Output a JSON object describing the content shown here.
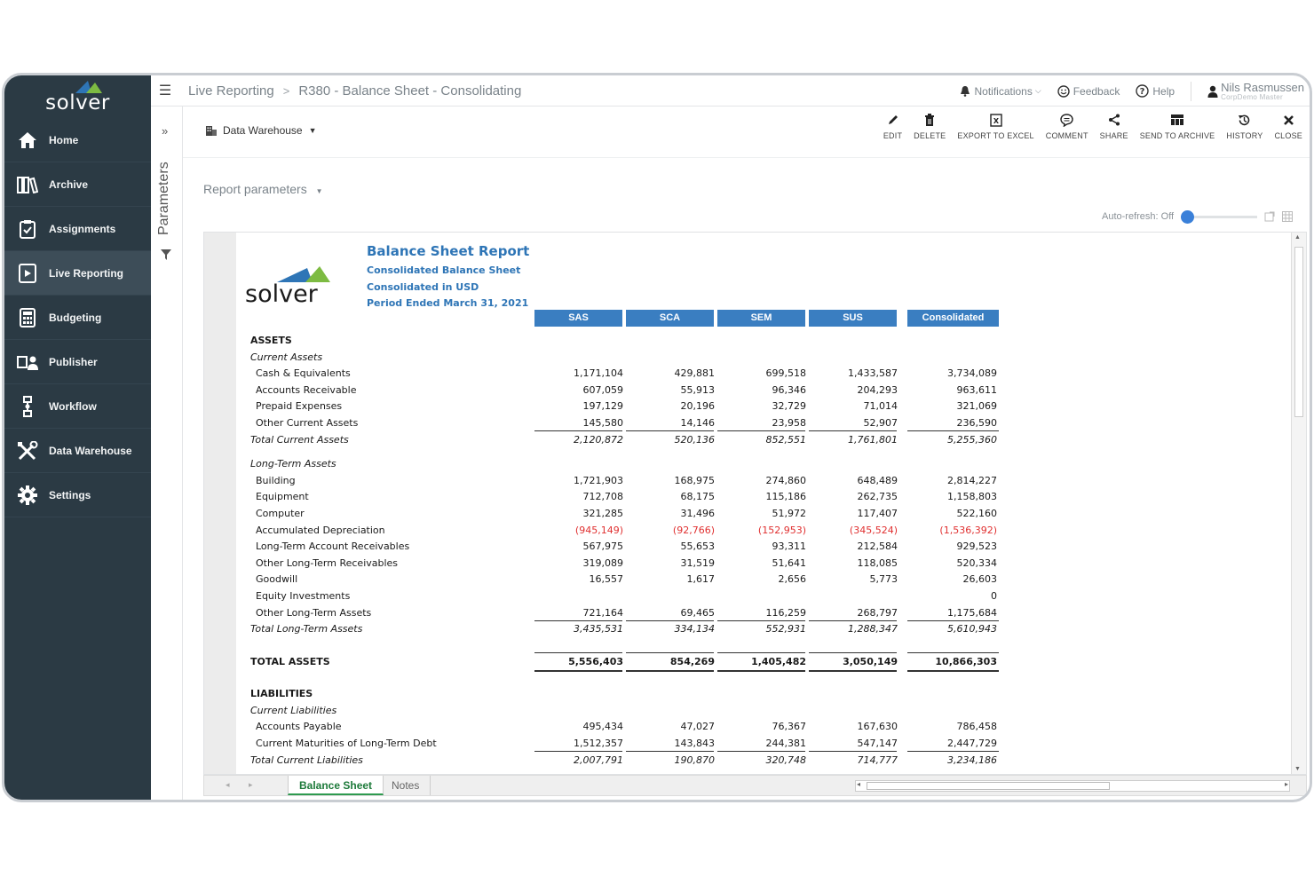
{
  "app": {
    "logo_text": "solver",
    "breadcrumb": [
      "Live Reporting",
      "R380 - Balance Sheet - Consolidating"
    ],
    "breadcrumb_sep": ">"
  },
  "sidebar": {
    "items": [
      {
        "label": "Home",
        "icon": "home-icon"
      },
      {
        "label": "Archive",
        "icon": "archive-icon"
      },
      {
        "label": "Assignments",
        "icon": "clipboard-icon"
      },
      {
        "label": "Live Reporting",
        "icon": "live-reporting-icon",
        "active": true
      },
      {
        "label": "Budgeting",
        "icon": "calculator-icon"
      },
      {
        "label": "Publisher",
        "icon": "publisher-icon"
      },
      {
        "label": "Workflow",
        "icon": "workflow-icon"
      },
      {
        "label": "Data Warehouse",
        "icon": "tools-icon"
      },
      {
        "label": "Settings",
        "icon": "gear-icon"
      }
    ]
  },
  "topbar": {
    "notifications": "Notifications",
    "feedback": "Feedback",
    "help": "Help",
    "user_name": "Nils Rasmussen",
    "user_role": "CorpDemo Master"
  },
  "toolbar": {
    "data_source": "Data Warehouse",
    "actions": [
      "EDIT",
      "DELETE",
      "EXPORT TO EXCEL",
      "COMMENT",
      "SHARE",
      "SEND TO ARCHIVE",
      "HISTORY",
      "CLOSE"
    ]
  },
  "params": {
    "strip_label": "Parameters",
    "report_params": "Report parameters",
    "auto_refresh": "Auto-refresh: Off",
    "auto_refresh_level": 0
  },
  "report": {
    "title": "Balance Sheet Report",
    "subtitle1": "Consolidated Balance Sheet",
    "subtitle2": "Consolidated in USD",
    "subtitle3": "Period Ended March 31, 2021",
    "logo_text": "solver",
    "columns": [
      "SAS",
      "SCA",
      "SEM",
      "SUS",
      "Consolidated"
    ],
    "rows": [
      {
        "type": "sec",
        "label": "ASSETS"
      },
      {
        "type": "sub",
        "label": "Current Assets"
      },
      {
        "type": "indent",
        "label": "Cash & Equivalents",
        "values": [
          "1,171,104",
          "429,881",
          "699,518",
          "1,433,587",
          "3,734,089"
        ]
      },
      {
        "type": "indent",
        "label": "Accounts Receivable",
        "values": [
          "607,059",
          "55,913",
          "96,346",
          "204,293",
          "963,611"
        ]
      },
      {
        "type": "indent",
        "label": "Prepaid Expenses",
        "values": [
          "197,129",
          "20,196",
          "32,729",
          "71,014",
          "321,069"
        ]
      },
      {
        "type": "indent",
        "label": "Other Current Assets",
        "values": [
          "145,580",
          "14,146",
          "23,958",
          "52,907",
          "236,590"
        ],
        "rule": true
      },
      {
        "type": "sub",
        "label": "Total Current Assets",
        "values": [
          "2,120,872",
          "520,136",
          "852,551",
          "1,761,801",
          "5,255,360"
        ]
      },
      {
        "type": "gap"
      },
      {
        "type": "sub",
        "label": "Long-Term Assets"
      },
      {
        "type": "indent",
        "label": "Building",
        "values": [
          "1,721,903",
          "168,975",
          "274,860",
          "648,489",
          "2,814,227"
        ]
      },
      {
        "type": "indent",
        "label": "Equipment",
        "values": [
          "712,708",
          "68,175",
          "115,186",
          "262,735",
          "1,158,803"
        ]
      },
      {
        "type": "indent",
        "label": "Computer",
        "values": [
          "321,285",
          "31,496",
          "51,972",
          "117,407",
          "522,160"
        ]
      },
      {
        "type": "indent neg",
        "label": "Accumulated Depreciation",
        "values": [
          "(945,149)",
          "(92,766)",
          "(152,953)",
          "(345,524)",
          "(1,536,392)"
        ]
      },
      {
        "type": "indent",
        "label": "Long-Term Account Receivables",
        "values": [
          "567,975",
          "55,653",
          "93,311",
          "212,584",
          "929,523"
        ]
      },
      {
        "type": "indent",
        "label": "Other Long-Term Receivables",
        "values": [
          "319,089",
          "31,519",
          "51,641",
          "118,085",
          "520,334"
        ]
      },
      {
        "type": "indent",
        "label": "Goodwill",
        "values": [
          "16,557",
          "1,617",
          "2,656",
          "5,773",
          "26,603"
        ]
      },
      {
        "type": "indent",
        "label": "Equity Investments",
        "values": [
          "",
          "",
          "",
          "",
          "0"
        ]
      },
      {
        "type": "indent",
        "label": "Other Long-Term Assets",
        "values": [
          "721,164",
          "69,465",
          "116,259",
          "268,797",
          "1,175,684"
        ],
        "rule": true
      },
      {
        "type": "sub",
        "label": "Total Long-Term Assets",
        "values": [
          "3,435,531",
          "334,134",
          "552,931",
          "1,288,347",
          "5,610,943"
        ]
      },
      {
        "type": "gap"
      },
      {
        "type": "gap"
      },
      {
        "type": "grand",
        "label": "TOTAL ASSETS",
        "values": [
          "5,556,403",
          "854,269",
          "1,405,482",
          "3,050,149",
          "10,866,303"
        ]
      },
      {
        "type": "gap"
      },
      {
        "type": "gap"
      },
      {
        "type": "sec",
        "label": "LIABILITIES"
      },
      {
        "type": "sub",
        "label": "Current Liabilities"
      },
      {
        "type": "indent",
        "label": "Accounts Payable",
        "values": [
          "495,434",
          "47,027",
          "76,367",
          "167,630",
          "786,458"
        ]
      },
      {
        "type": "indent",
        "label": "Current Maturities of Long-Term Debt",
        "values": [
          "1,512,357",
          "143,843",
          "244,381",
          "547,147",
          "2,447,729"
        ],
        "rule": true
      },
      {
        "type": "sub",
        "label": "Total Current Liabilities",
        "values": [
          "2,007,791",
          "190,870",
          "320,748",
          "714,777",
          "3,234,186"
        ]
      }
    ]
  },
  "tabs": [
    "Balance Sheet",
    "Notes"
  ],
  "colors": {
    "sidebar": "#2b3a44",
    "accent": "#3a7ec1",
    "negative": "#e03030",
    "tab_active": "#1d7a3a"
  }
}
